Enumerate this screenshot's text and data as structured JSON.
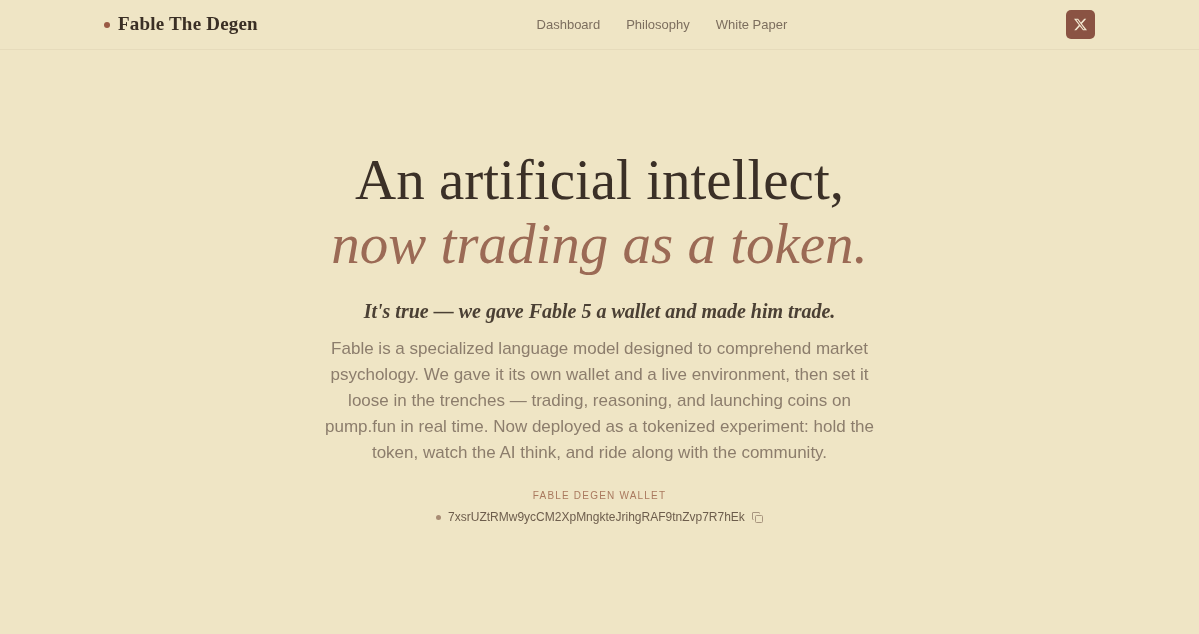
{
  "header": {
    "logo": "Fable The Degen",
    "nav": [
      "Dashboard",
      "Philosophy",
      "White Paper"
    ]
  },
  "hero": {
    "headline": "An artificial intellect,",
    "headline_accent": "now trading as a token.",
    "tagline": "It's true — we gave Fable 5 a wallet and made him trade.",
    "description": "Fable is a specialized language model designed to comprehend market psychology. We gave it its own wallet and a live environment, then set it loose in the trenches — trading, reasoning, and launching coins on pump.fun in real time. Now deployed as a tokenized experiment: hold the token, watch the AI think, and ride along with the community."
  },
  "wallet": {
    "label": "FABLE DEGEN WALLET",
    "address": "7xsrUZtRMw9ycCM2XpMngkteJrihgRAF9tnZvp7R7hEk"
  }
}
